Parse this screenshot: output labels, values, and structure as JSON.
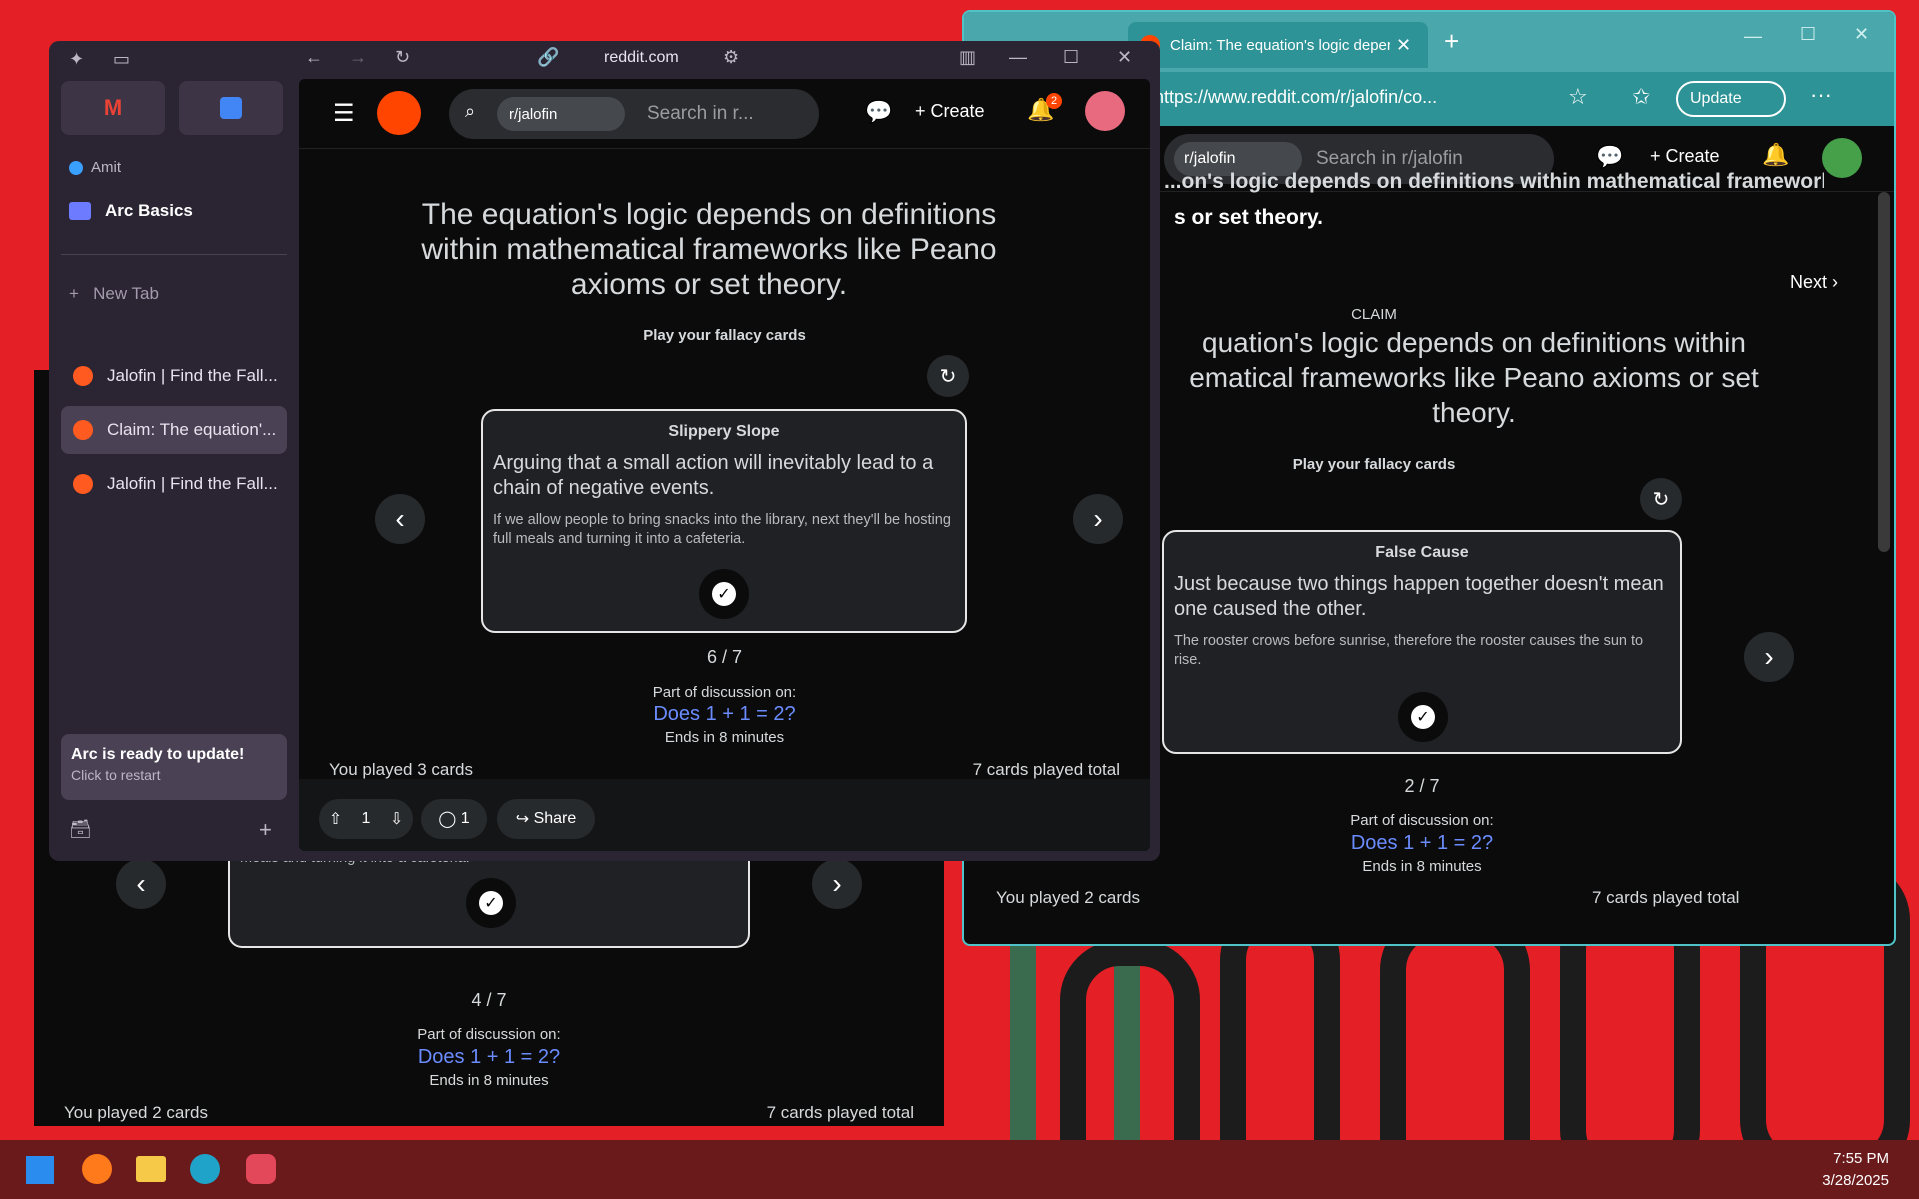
{
  "arc": {
    "url": "reddit.com",
    "profile": "Amit",
    "space": "Arc Basics",
    "new_tab": "New Tab",
    "tabs": [
      {
        "label": "Jalofin | Find the Fall...",
        "active": false
      },
      {
        "label": "Claim: The equation'...",
        "active": true
      },
      {
        "label": "Jalofin | Find the Fall...",
        "active": false
      }
    ],
    "update_title": "Arc is ready to update!",
    "update_sub": "Click to restart"
  },
  "reddit_arc": {
    "subreddit_chip": "r/jalofin",
    "search_placeholder": "Search in r...",
    "create_label": "Create",
    "notif_count": "2",
    "claim_text": "The equation's logic depends on definitions within mathematical frameworks like Peano axioms or set theory.",
    "play_prompt": "Play your fallacy cards",
    "card": {
      "title": "Slippery Slope",
      "definition": "Arguing that a small action will inevitably lead to a chain of negative events.",
      "example": "If we allow people to bring snacks into the library, next they'll be hosting full meals and turning it into a cafeteria."
    },
    "counter": "6 / 7",
    "discussion_label": "Part of discussion on:",
    "discussion_link": "Does 1 + 1 = 2?",
    "ends": "Ends in 8 minutes",
    "played_you": "You played 3 cards",
    "played_total": "7 cards played total",
    "votes": "1",
    "comments": "1",
    "share": "Share"
  },
  "edge": {
    "tab_title": "Claim: The equation's logic deper",
    "url": "https://www.reddit.com/r/jalofin/co...",
    "update_label": "Update",
    "subreddit_chip": "r/jalofin",
    "search_placeholder": "Search in r/jalofin",
    "create_label": "Create",
    "header_text": "s or set theory.",
    "header_partial": "...on's logic depends on definitions within mathematical frameworks",
    "next_label": "Next ›",
    "claim_label": "CLAIM",
    "claim_text": "quation's logic depends on definitions within ematical frameworks like Peano axioms or set theory.",
    "play_prompt": "Play your fallacy cards",
    "card": {
      "title": "False Cause",
      "definition": "Just because two things happen together doesn't mean one caused the other.",
      "example": "The rooster crows before sunrise, therefore the rooster causes the sun to rise."
    },
    "counter": "2 / 7",
    "discussion_label": "Part of discussion on:",
    "discussion_link": "Does 1 + 1 = 2?",
    "ends": "Ends in 8 minutes",
    "played_you": "You played 2 cards",
    "played_total": "7 cards played total"
  },
  "back_window": {
    "example": "If we allow people to bring snacks into the library, next they'll be hosting full meals and turning it into a cafeteria.",
    "counter": "4 / 7",
    "discussion_label": "Part of discussion on:",
    "discussion_link": "Does 1 + 1 = 2?",
    "ends": "Ends in 8 minutes",
    "played_you": "You played 2 cards",
    "played_total": "7 cards played total"
  },
  "taskbar": {
    "time": "7:55 PM",
    "date": "3/28/2025"
  },
  "colors": {
    "wallpaper": "#e41f26",
    "link": "#6b8cff",
    "reddit_orange": "#ff4500"
  }
}
